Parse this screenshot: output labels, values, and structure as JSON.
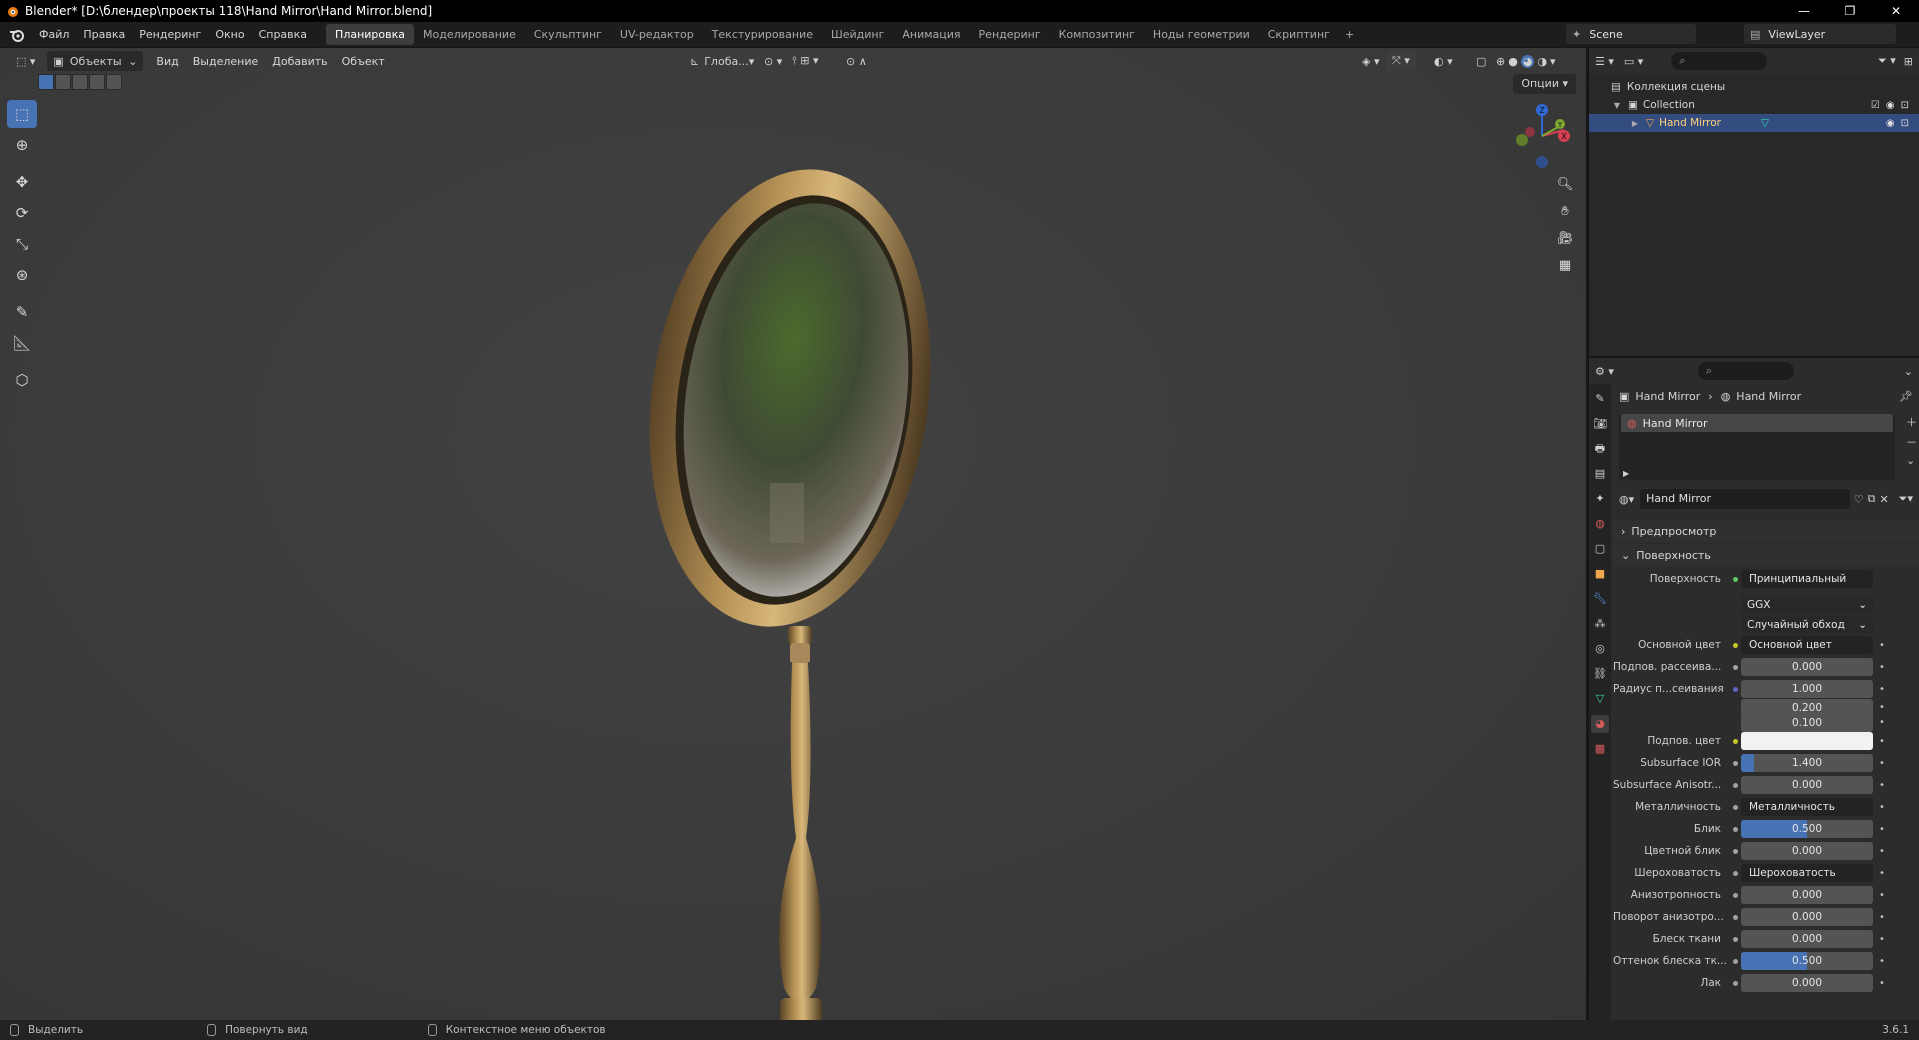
{
  "window": {
    "title": "Blender* [D:\\блендер\\проекты 118\\Hand Mirror\\Hand Mirror.blend]",
    "controls": [
      "—",
      "❐",
      "✕"
    ]
  },
  "menu": [
    "Файл",
    "Правка",
    "Рендеринг",
    "Окно",
    "Справка"
  ],
  "workspaces": [
    "Планировка",
    "Моделирование",
    "Скульптинг",
    "UV-редактор",
    "Текстурирование",
    "Шейдинг",
    "Анимация",
    "Рендеринг",
    "Композитинг",
    "Ноды геометрии",
    "Скриптинг",
    "+"
  ],
  "active_workspace": "Планировка",
  "scene": {
    "name": "Scene",
    "view_layer": "ViewLayer"
  },
  "viewport": {
    "mode": "Объекты",
    "menu": [
      "Вид",
      "Выделение",
      "Добавить",
      "Объект"
    ],
    "transform_orientation": "Глоба...",
    "options_label": "Опции"
  },
  "outliner": {
    "root": "Коллекция сцены",
    "collection": "Collection",
    "object": "Hand Mirror"
  },
  "properties": {
    "breadcrumb_object": "Hand Mirror",
    "breadcrumb_material": "Hand Mirror",
    "slot": "Hand Mirror",
    "material_name": "Hand Mirror",
    "panels": {
      "preview": "Предпросмотр",
      "surface": "Поверхность"
    },
    "surface_label": "Поверхность",
    "surface_value": "Принципиальный BSDF",
    "distribution": "GGX",
    "subsurface_method": "Случайный обход",
    "rows": [
      {
        "label": "Основной цвет",
        "value": "Основной цвет",
        "kind": "link",
        "socket": "#c7c729"
      },
      {
        "label": "Подпов. рассеива...",
        "value": "0.000",
        "kind": "num",
        "socket": "#a1a1a1",
        "fill": 0
      },
      {
        "label": "Радиус п...сеивания",
        "value": "1.000",
        "kind": "num",
        "socket": "#6363c7",
        "fill": 0
      },
      {
        "label": "",
        "value": "0.200",
        "kind": "num",
        "socket": "",
        "fill": 0
      },
      {
        "label": "",
        "value": "0.100",
        "kind": "num",
        "socket": "",
        "fill": 0
      },
      {
        "label": "Подпов. цвет",
        "value": "",
        "kind": "color",
        "socket": "#c7c729"
      },
      {
        "label": "Subsurface IOR",
        "value": "1.400",
        "kind": "num",
        "socket": "#a1a1a1",
        "fill": 0.1
      },
      {
        "label": "Subsurface Anisotr...",
        "value": "0.000",
        "kind": "num",
        "socket": "#a1a1a1",
        "fill": 0
      },
      {
        "label": "Металличность",
        "value": "Металличность",
        "kind": "link",
        "socket": "#a1a1a1"
      },
      {
        "label": "Блик",
        "value": "0.500",
        "kind": "num",
        "socket": "#a1a1a1",
        "fill": 0.5
      },
      {
        "label": "Цветной блик",
        "value": "0.000",
        "kind": "num",
        "socket": "#a1a1a1",
        "fill": 0
      },
      {
        "label": "Шероховатость",
        "value": "Шероховатость",
        "kind": "link",
        "socket": "#a1a1a1"
      },
      {
        "label": "Анизотропность",
        "value": "0.000",
        "kind": "num",
        "socket": "#a1a1a1",
        "fill": 0
      },
      {
        "label": "Поворот анизотро...",
        "value": "0.000",
        "kind": "num",
        "socket": "#a1a1a1",
        "fill": 0
      },
      {
        "label": "Блеск ткани",
        "value": "0.000",
        "kind": "num",
        "socket": "#a1a1a1",
        "fill": 0
      },
      {
        "label": "Оттенок блеска тк...",
        "value": "0.500",
        "kind": "num",
        "socket": "#a1a1a1",
        "fill": 0.5
      },
      {
        "label": "Лак",
        "value": "0.000",
        "kind": "num",
        "socket": "#a1a1a1",
        "fill": 0
      }
    ]
  },
  "statusbar": {
    "select": "Выделить",
    "rotate": "Повернуть вид",
    "context": "Контекстное меню объектов",
    "version": "3.6.1"
  },
  "colors": {
    "accent": "#4772b3",
    "selection": "#334d80"
  }
}
